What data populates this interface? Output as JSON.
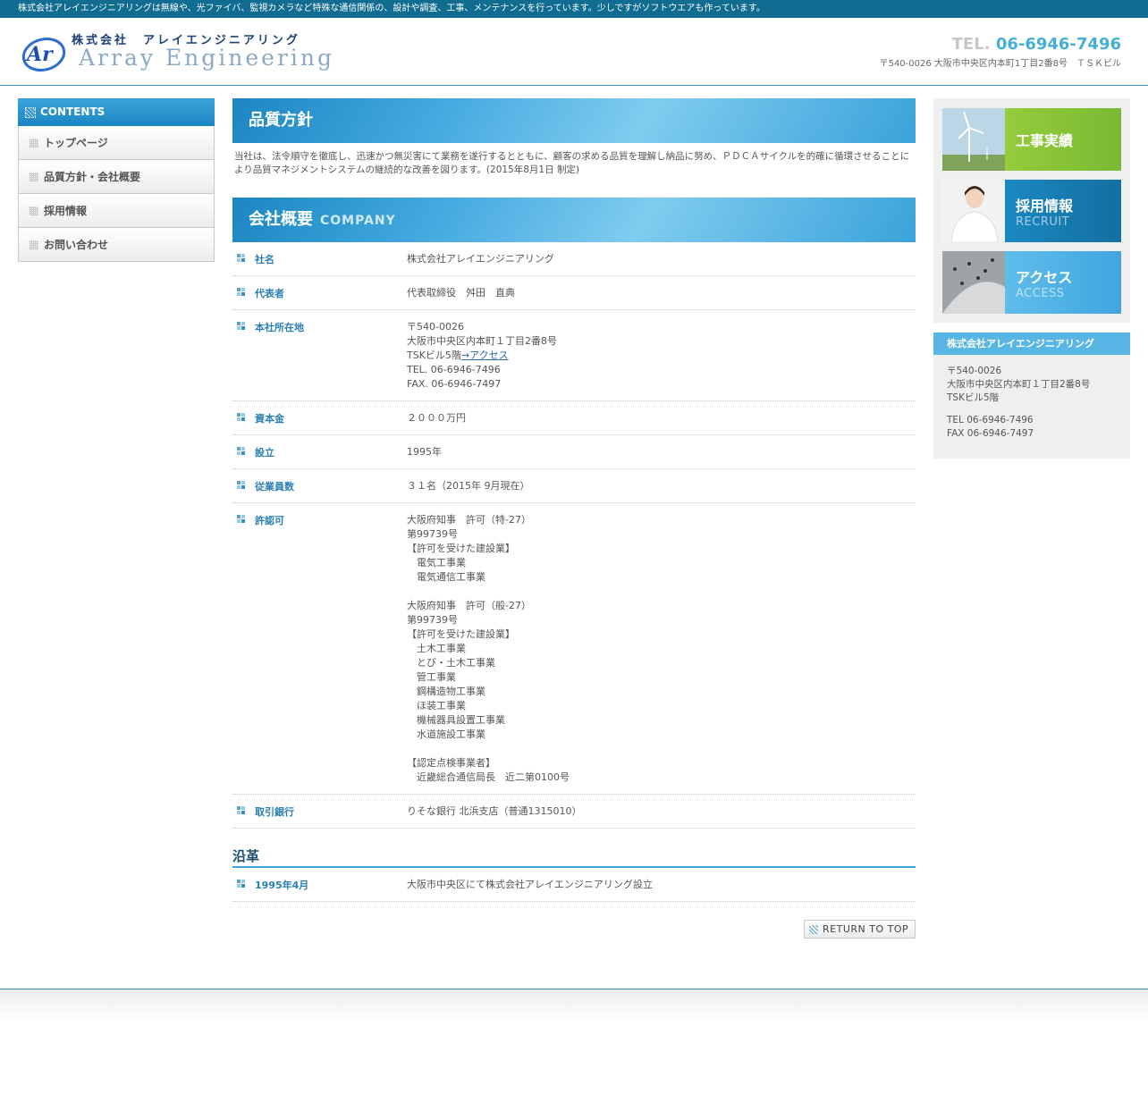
{
  "topbar": {
    "text": "株式会社アレイエンジニアリングは無線や、光ファイバ、監視カメラなど特殊な通信関係の、設計や調査、工事、メンテナンスを行っています。少しですがソフトウエアも作っています。"
  },
  "header": {
    "logo_mark": "Ar",
    "logo_jp": "株式会社　アレイエンジニアリング",
    "logo_en": "Array Engineering",
    "tel_label": "TEL.",
    "tel_number": "06-6946-7496",
    "address": "〒540-0026 大阪市中央区内本町1丁目2番8号　ＴＳＫビル"
  },
  "sidebar": {
    "title": "CONTENTS",
    "items": [
      {
        "label": "トップページ"
      },
      {
        "label": "品質方針・会社概要"
      },
      {
        "label": "採用情報"
      },
      {
        "label": "お問い合わせ"
      }
    ]
  },
  "policy": {
    "title": "品質方針",
    "text": "当社は、法令順守を徹底し、迅速かつ無災害にて業務を遂行するとともに、顧客の求める品質を理解し納品に努め、ＰＤＣＡサイクルを的確に循環させることにより品質マネジメントシステムの継続的な改善を図ります。(2015年8月1日 制定)"
  },
  "company": {
    "title": "会社概要",
    "subtitle": "COMPANY",
    "rows": [
      {
        "label": "社名",
        "value": "株式会社アレイエンジニアリング"
      },
      {
        "label": "代表者",
        "value": "代表取締役　舛田　直典"
      },
      {
        "label": "本社所在地",
        "value_a": "〒540-0026\n大阪市中央区内本町１丁目2番8号\nTSKビル5階",
        "link": "→アクセス",
        "value_b": "TEL. 06-6946-7496\nFAX. 06-6946-7497"
      },
      {
        "label": "資本金",
        "value": "２０００万円"
      },
      {
        "label": "設立",
        "value": "1995年"
      },
      {
        "label": "従業員数",
        "value": "３１名（2015年 9月現在）"
      },
      {
        "label": "許認可",
        "value": "大阪府知事　許可（特-27）\n第99739号\n【許可を受けた建設業】\n　電気工事業\n　電気通信工事業\n\n大阪府知事　許可（般-27）\n第99739号\n【許可を受けた建設業】\n　土木工事業\n　とび・土木工事業\n　管工事業\n　鋼構造物工事業\n　ほ装工事業\n　機械器具設置工事業\n　水道施設工事業\n\n【認定点検事業者】\n　近畿総合通信局長　近二第0100号"
      },
      {
        "label": "取引銀行",
        "value": "りそな銀行 北浜支店（普通1315010）"
      }
    ]
  },
  "history": {
    "title": "沿革",
    "rows": [
      {
        "label": "1995年4月",
        "value": "大阪市中央区にて株式会社アレイエンジニアリング設立"
      }
    ]
  },
  "return_top": {
    "label": "RETURN TO TOP"
  },
  "right_banners": [
    {
      "jp": "工事実績",
      "en": "",
      "color": "#8cc63f"
    },
    {
      "jp": "採用情報",
      "en": "RECRUIT",
      "color": "#1a88c0"
    },
    {
      "jp": "アクセス",
      "en": "ACCESS",
      "color": "#4fb3e6"
    }
  ],
  "info_box": {
    "title": "株式会社アレイエンジニアリング",
    "address": "〒540-0026\n大阪市中央区内本町１丁目2番8号\nTSKビル5階",
    "tel": "TEL 06-6946-7496",
    "fax": "FAX 06-6946-7497"
  }
}
